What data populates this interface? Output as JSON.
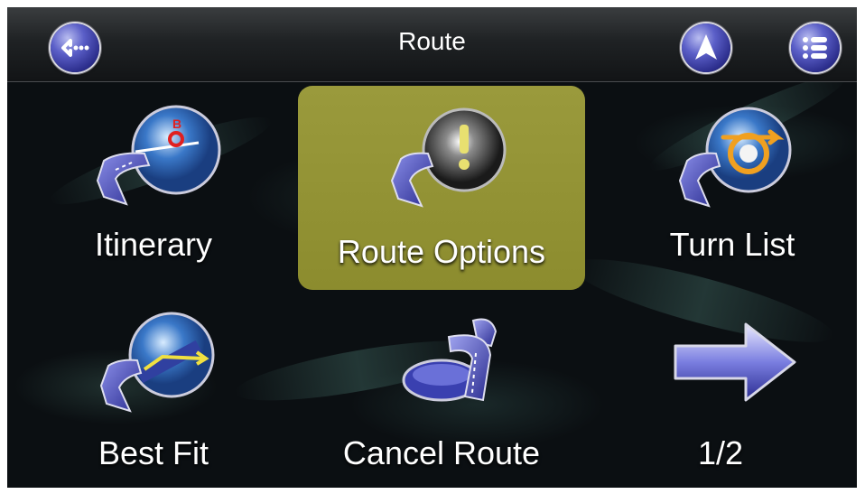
{
  "header": {
    "title": "Route"
  },
  "menu": {
    "items": [
      {
        "label": "Itinerary"
      },
      {
        "label": "Route Options"
      },
      {
        "label": "Turn List"
      },
      {
        "label": "Best Fit"
      },
      {
        "label": "Cancel Route"
      },
      {
        "label": "1/2"
      }
    ],
    "selected_item": "Route Options"
  },
  "colors": {
    "selected_tile": "#9a9a3c",
    "button_blue": "#3a3cb0",
    "background": "#0b0f12"
  },
  "icons": [
    "back-icon",
    "navigate-arrow-icon",
    "list-menu-icon",
    "itinerary-icon",
    "route-options-icon",
    "turn-list-icon",
    "best-fit-icon",
    "cancel-route-icon",
    "next-page-arrow-icon"
  ]
}
